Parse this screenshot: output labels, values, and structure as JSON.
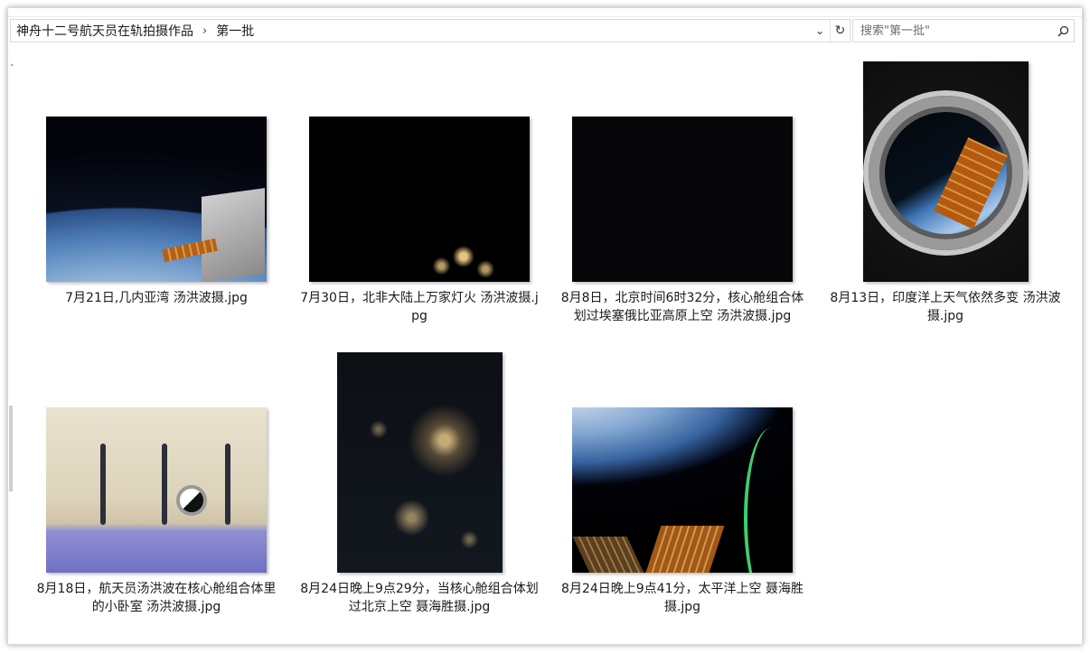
{
  "address_bar": {
    "path": [
      "神舟十二号航天员在轨拍摄作品",
      "第一批"
    ],
    "separator": "›",
    "dropdown_glyph": "⌄",
    "refresh_glyph": "↻"
  },
  "search": {
    "placeholder": "搜索\"第一批\""
  },
  "files": [
    {
      "name": "7月21日,几内亚湾 汤洪波摄.jpg"
    },
    {
      "name": "7月30日，北非大陆上万家灯火 汤洪波摄.jpg"
    },
    {
      "name": "8月8日，北京时间6时32分，核心舱组合体划过埃塞俄比亚高原上空 汤洪波摄.jpg"
    },
    {
      "name": "8月13日，印度洋上天气依然多变 汤洪波摄.jpg"
    },
    {
      "name": "8月18日，航天员汤洪波在核心舱组合体里的小卧室 汤洪波摄.jpg"
    },
    {
      "name": "8月24日晚上9点29分，当核心舱组合体划过北京上空 聂海胜摄.jpg"
    },
    {
      "name": "8月24日晚上9点41分，太平洋上空 聂海胜摄.jpg"
    }
  ]
}
